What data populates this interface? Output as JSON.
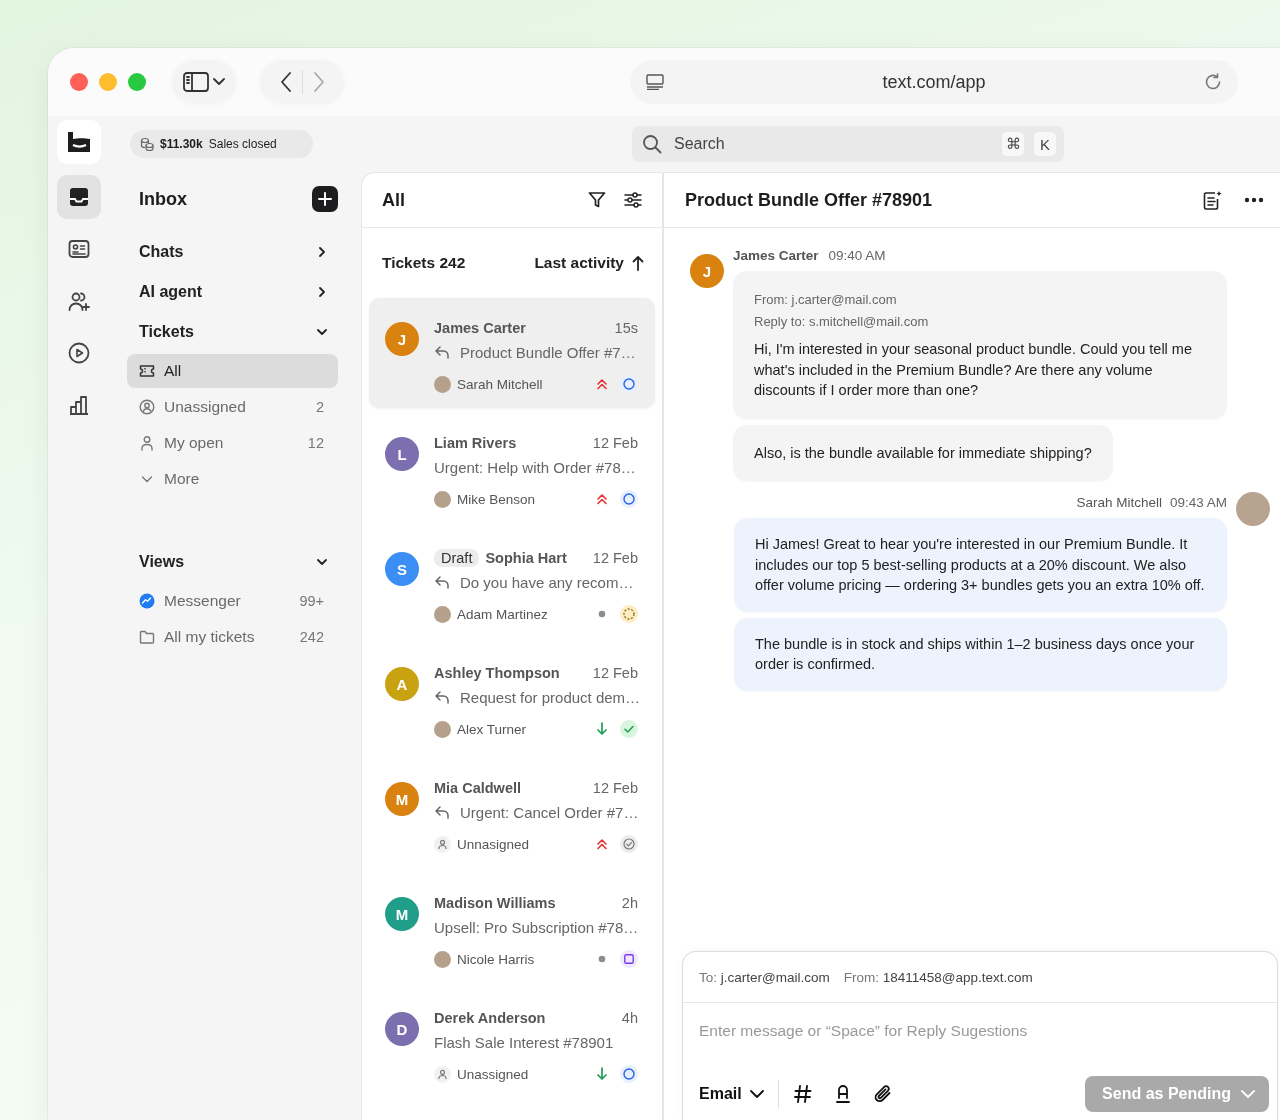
{
  "window": {
    "url": "text.com/app"
  },
  "toolbar": {
    "sales_amount": "$11.30k",
    "sales_label": "Sales closed",
    "search": {
      "placeholder": "Search",
      "keys": [
        "⌘",
        "K"
      ]
    }
  },
  "rail": {
    "items": [
      {
        "selected": true
      },
      {
        "selected": false
      },
      {
        "selected": false
      },
      {
        "selected": false
      },
      {
        "selected": false
      }
    ]
  },
  "sidebar": {
    "title": "Inbox",
    "sections": [
      {
        "label": "Chats",
        "expanded": false
      },
      {
        "label": "AI agent",
        "expanded": false
      },
      {
        "label": "Tickets",
        "expanded": true,
        "items": [
          {
            "label": "All",
            "selected": true
          },
          {
            "label": "Unassigned",
            "count": "2",
            "selected": false
          },
          {
            "label": "My open",
            "count": "12",
            "selected": false
          },
          {
            "label": "More",
            "selected": false
          }
        ]
      },
      {
        "label": "Views",
        "expanded": true,
        "items": [
          {
            "label": "Messenger",
            "count": "99+",
            "selected": false
          },
          {
            "label": "All my tickets",
            "count": "242",
            "selected": false
          }
        ]
      }
    ]
  },
  "ticket_list": {
    "title": "All",
    "count_label": "Tickets 242",
    "sort_label": "Last activity",
    "tickets": [
      {
        "initial": "J",
        "color": "#d9820f",
        "name": "James Carter",
        "time": "15s",
        "replied": true,
        "subject": "Product Bundle Offer #7…",
        "assignee": "Sarah Mitchell",
        "assigned": true,
        "priority": {
          "kind": "urgent"
        },
        "status": {
          "kind": "open"
        },
        "selected": true
      },
      {
        "initial": "L",
        "color": "#7b6fb0",
        "name": "Liam Rivers",
        "time": "12 Feb",
        "replied": false,
        "subject": "Urgent: Help with Order #78…",
        "assignee": "Mike Benson",
        "assigned": true,
        "priority": {
          "kind": "urgent"
        },
        "status": {
          "kind": "open"
        },
        "selected": false
      },
      {
        "initial": "S",
        "color": "#3b8ef3",
        "draft": "Draft",
        "name": "Sophia Hart",
        "time": "12 Feb",
        "replied": true,
        "subject": "Do you have any recom…",
        "assignee": "Adam Martinez",
        "assigned": true,
        "priority": {
          "kind": "medium"
        },
        "status": {
          "kind": "pending"
        },
        "selected": false
      },
      {
        "initial": "A",
        "color": "#c9a211",
        "name": "Ashley Thompson",
        "time": "12 Feb",
        "replied": true,
        "subject": "Request for product dem…",
        "assignee": "Alex Turner",
        "assigned": true,
        "priority": {
          "kind": "low"
        },
        "status": {
          "kind": "resolved"
        },
        "selected": false
      },
      {
        "initial": "M",
        "color": "#d9820f",
        "name": "Mia Caldwell",
        "time": "12 Feb",
        "replied": true,
        "subject": "Urgent: Cancel Order #7…",
        "assignee": "Unnasigned",
        "assigned": false,
        "priority": {
          "kind": "urgent"
        },
        "status": {
          "kind": "closed"
        },
        "selected": false
      },
      {
        "initial": "M",
        "color": "#219e8a",
        "name": "Madison Williams",
        "time": "2h",
        "replied": false,
        "subject": "Upsell: Pro Subscription #78…",
        "assignee": "Nicole Harris",
        "assigned": true,
        "priority": {
          "kind": "medium"
        },
        "status": {
          "kind": "review"
        },
        "selected": false
      },
      {
        "initial": "D",
        "color": "#7b6fb0",
        "name": "Derek Anderson",
        "time": "4h",
        "replied": false,
        "subject": "Flash Sale Interest #78901",
        "assignee": "Unassigned",
        "assigned": false,
        "priority": {
          "kind": "low"
        },
        "status": {
          "kind": "open"
        },
        "selected": false
      }
    ]
  },
  "conversation": {
    "title": "Product Bundle Offer #78901",
    "messages": [
      {
        "kind": "incoming",
        "initial": "J",
        "color": "#d9820f",
        "author": "James Carter",
        "time": "09:40 AM",
        "bubbles": [
          {
            "from": "From: j.carter@mail.com",
            "reply_to": "Reply to: s.mitchell@mail.com",
            "text": "Hi, I'm interested in your seasonal product bundle. Could you tell me what's included in the Premium Bundle? Are there any volume discounts if I order more than one?"
          },
          {
            "text": "Also, is the bundle available for immediate shipping?"
          }
        ]
      },
      {
        "kind": "outgoing",
        "author": "Sarah Mitchell",
        "time": "09:43 AM",
        "bubbles": [
          {
            "text": "Hi James! Great to hear you're interested in our Premium Bundle. It includes our top 5 best-selling products at a 20% discount. We also offer volume pricing — ordering 3+ bundles gets you an extra 10% off."
          },
          {
            "text": "The bundle is in stock and ships within 1–2 business days once your order is confirmed."
          }
        ]
      }
    ]
  },
  "composer": {
    "to_label": "To:",
    "to": "j.carter@mail.com",
    "from_label": "From:",
    "from": "18411458@app.text.com",
    "placeholder": "Enter message or “Space” for Reply Sugestions",
    "channel": "Email",
    "send_label": "Send as Pending",
    "send_disabled": true
  }
}
